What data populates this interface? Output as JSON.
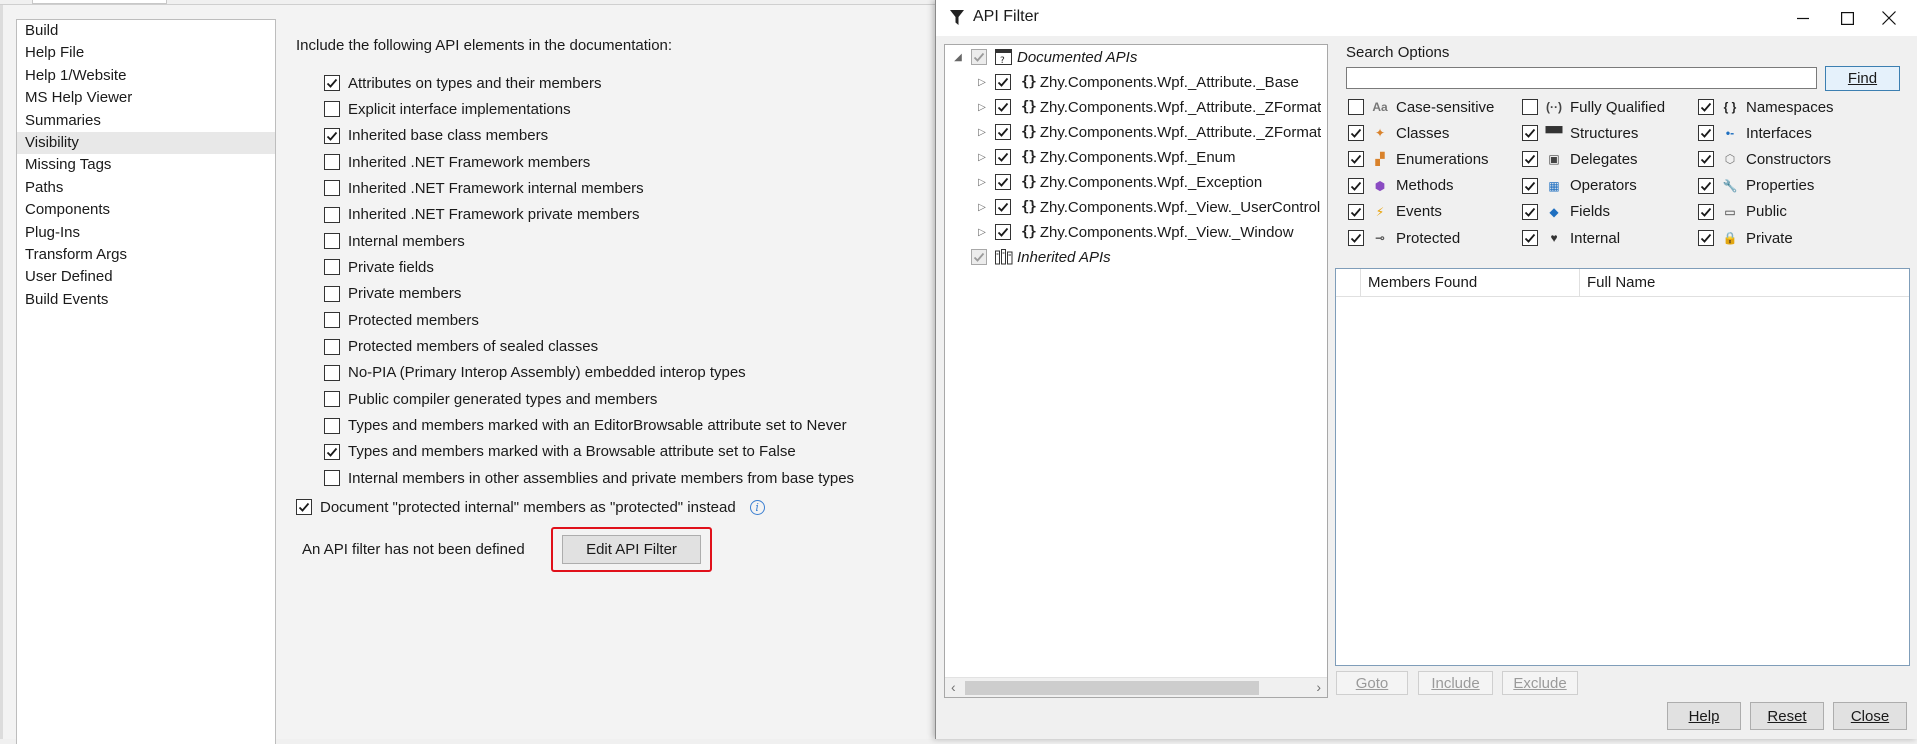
{
  "nav": {
    "items": [
      "Build",
      "Help File",
      "Help 1/Website",
      "MS Help Viewer",
      "Summaries",
      "Visibility",
      "Missing Tags",
      "Paths",
      "Components",
      "Plug-Ins",
      "Transform Args",
      "User Defined",
      "Build Events"
    ],
    "selected": "Visibility"
  },
  "visibility": {
    "intro": "Include the following API elements in the documentation:",
    "options": [
      {
        "label": "Attributes on types and their members",
        "checked": true
      },
      {
        "label": "Explicit interface implementations",
        "checked": false
      },
      {
        "label": "Inherited base class members",
        "checked": true
      },
      {
        "label": "Inherited .NET Framework members",
        "checked": false
      },
      {
        "label": "Inherited .NET Framework internal members",
        "checked": false
      },
      {
        "label": "Inherited .NET Framework private members",
        "checked": false
      },
      {
        "label": "Internal members",
        "checked": false
      },
      {
        "label": "Private fields",
        "checked": false
      },
      {
        "label": "Private members",
        "checked": false
      },
      {
        "label": "Protected members",
        "checked": false
      },
      {
        "label": "Protected members of sealed classes",
        "checked": false
      },
      {
        "label": "No-PIA (Primary Interop Assembly) embedded interop types",
        "checked": false
      },
      {
        "label": "Public compiler generated types and members",
        "checked": false
      },
      {
        "label": "Types and members marked with an EditorBrowsable attribute set to Never",
        "checked": false
      },
      {
        "label": "Types and members marked with a Browsable attribute set to False",
        "checked": true
      },
      {
        "label": "Internal members in other assemblies and private members from base types",
        "checked": false
      }
    ],
    "protected_internal": {
      "label": "Document \"protected internal\" members as \"protected\" instead",
      "checked": true
    },
    "filter_status": "An API filter has not been defined",
    "edit_filter_button": "Edit API Filter"
  },
  "dialog": {
    "title": "API Filter",
    "tree": {
      "root": {
        "label": "Documented APIs",
        "checked": true
      },
      "namespaces": [
        {
          "label": "Zhy.Components.Wpf._Attribute._Base",
          "checked": true
        },
        {
          "label": "Zhy.Components.Wpf._Attribute._ZFormat",
          "checked": true
        },
        {
          "label": "Zhy.Components.Wpf._Attribute._ZFormat",
          "checked": true
        },
        {
          "label": "Zhy.Components.Wpf._Enum",
          "checked": true
        },
        {
          "label": "Zhy.Components.Wpf._Exception",
          "checked": true
        },
        {
          "label": "Zhy.Components.Wpf._View._UserControl",
          "checked": true
        },
        {
          "label": "Zhy.Components.Wpf._View._Window",
          "checked": true
        }
      ],
      "inherited": {
        "label": "Inherited APIs",
        "checked": true
      }
    },
    "search": {
      "title": "Search Options",
      "value": "",
      "find_button": "Find",
      "options": [
        {
          "label": "Case-sensitive",
          "checked": false,
          "icon": "case-sensitive-icon",
          "glyph": "Aa",
          "color": "#777777"
        },
        {
          "label": "Fully Qualified",
          "checked": false,
          "icon": "fully-qualified-icon",
          "glyph": "(··)",
          "color": "#444444"
        },
        {
          "label": "Namespaces",
          "checked": true,
          "icon": "namespace-icon",
          "glyph": "{ }",
          "color": "#222222"
        },
        {
          "label": "Classes",
          "checked": true,
          "icon": "class-icon",
          "glyph": "✦",
          "color": "#d9822b"
        },
        {
          "label": "Structures",
          "checked": true,
          "icon": "structure-icon",
          "glyph": "▀▀",
          "color": "#333333"
        },
        {
          "label": "Interfaces",
          "checked": true,
          "icon": "interface-icon",
          "glyph": "•-",
          "color": "#1f6fc0"
        },
        {
          "label": "Enumerations",
          "checked": true,
          "icon": "enumeration-icon",
          "glyph": "▞",
          "color": "#d9822b"
        },
        {
          "label": "Delegates",
          "checked": true,
          "icon": "delegate-icon",
          "glyph": "▣",
          "color": "#444444"
        },
        {
          "label": "Constructors",
          "checked": true,
          "icon": "constructor-icon",
          "glyph": "⬡",
          "color": "#777777"
        },
        {
          "label": "Methods",
          "checked": true,
          "icon": "method-icon",
          "glyph": "⬢",
          "color": "#8a4bc2"
        },
        {
          "label": "Operators",
          "checked": true,
          "icon": "operator-icon",
          "glyph": "▦",
          "color": "#1f6fc0"
        },
        {
          "label": "Properties",
          "checked": true,
          "icon": "property-icon",
          "glyph": "🔧",
          "color": "#333333"
        },
        {
          "label": "Events",
          "checked": true,
          "icon": "event-icon",
          "glyph": "⚡",
          "color": "#e8a000"
        },
        {
          "label": "Fields",
          "checked": true,
          "icon": "field-icon",
          "glyph": "◆",
          "color": "#1f6fc0"
        },
        {
          "label": "Public",
          "checked": true,
          "icon": "public-icon",
          "glyph": "▭",
          "color": "#333333"
        },
        {
          "label": "Protected",
          "checked": true,
          "icon": "protected-icon",
          "glyph": "⊸",
          "color": "#555555"
        },
        {
          "label": "Internal",
          "checked": true,
          "icon": "internal-icon",
          "glyph": "♥",
          "color": "#333333"
        },
        {
          "label": "Private",
          "checked": true,
          "icon": "private-icon",
          "glyph": "🔒",
          "color": "#333333"
        }
      ]
    },
    "results": {
      "columns": [
        "Members Found",
        "Full Name"
      ],
      "rows": []
    },
    "goto_button": "Goto",
    "include_button": "Include",
    "exclude_button": "Exclude",
    "help_button": "Help",
    "reset_button": "Reset",
    "close_button": "Close"
  }
}
